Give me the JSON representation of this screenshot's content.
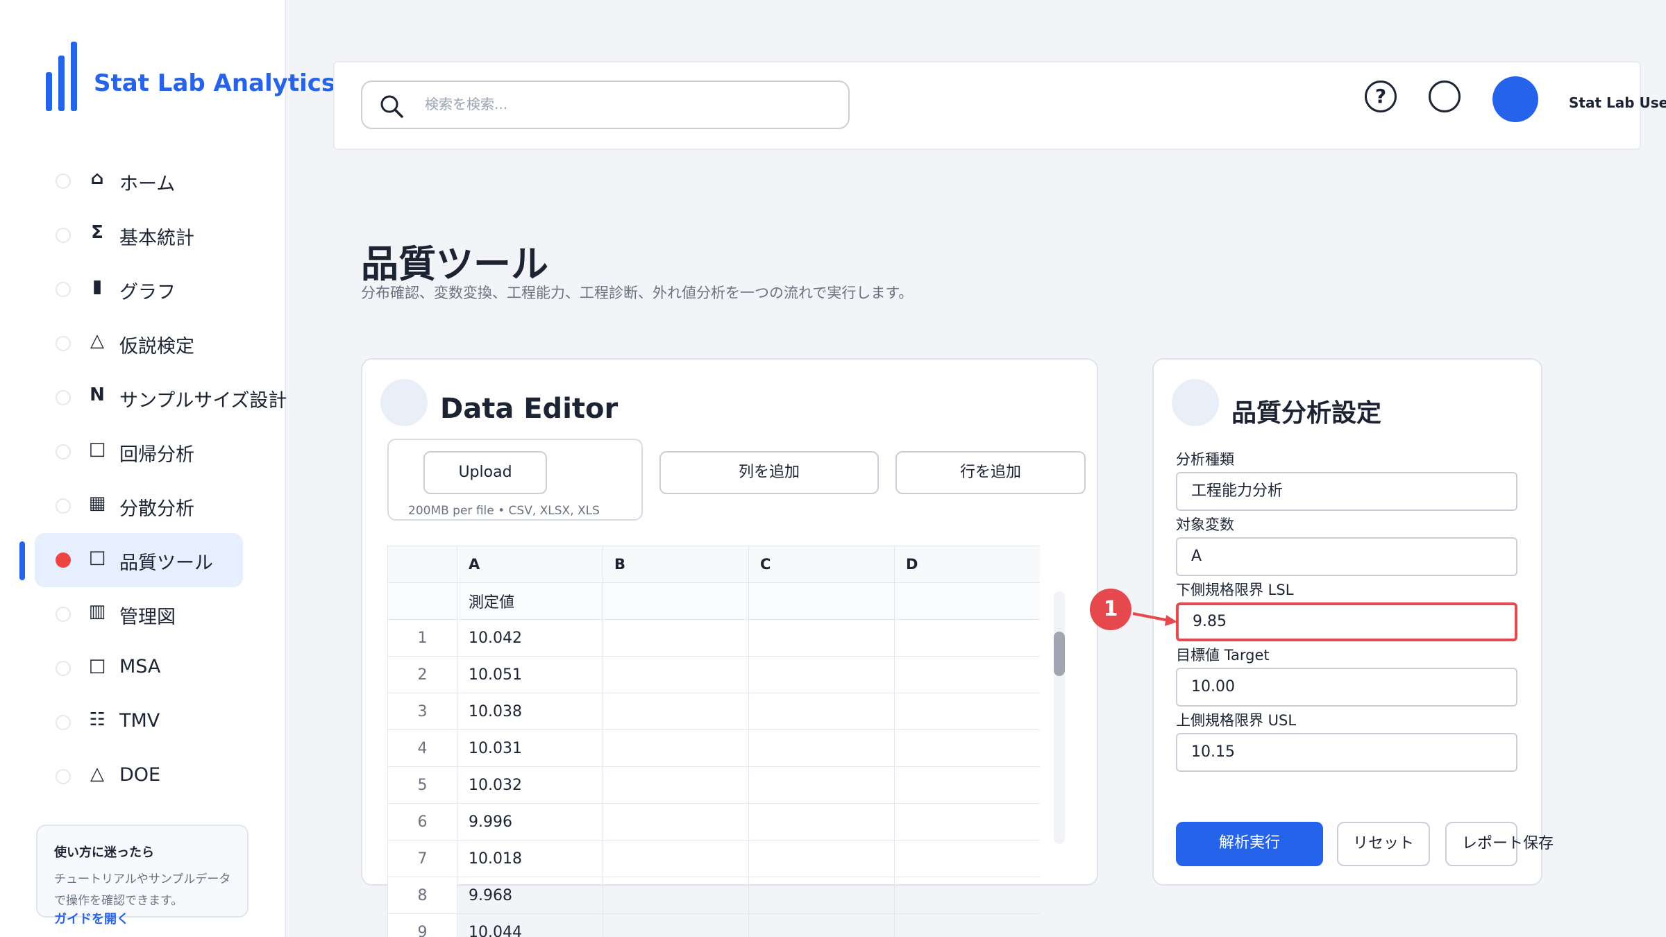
{
  "brand": {
    "name": "Stat Lab Analytics"
  },
  "sidebar": {
    "items": [
      {
        "glyph": "⌂",
        "label": "ホーム"
      },
      {
        "glyph": "Σ",
        "label": "基本統計"
      },
      {
        "glyph": "▮",
        "label": "グラフ"
      },
      {
        "glyph": "△",
        "label": "仮説検定"
      },
      {
        "glyph": "N",
        "label": "サンプルサイズ設計"
      },
      {
        "glyph": "□",
        "label": "回帰分析"
      },
      {
        "glyph": "▦",
        "label": "分散分析"
      },
      {
        "glyph": "□",
        "label": "品質ツール",
        "active": true
      },
      {
        "glyph": "▥",
        "label": "管理図"
      },
      {
        "glyph": "□",
        "label": "MSA"
      },
      {
        "glyph": "☷",
        "label": "TMV"
      },
      {
        "glyph": "△",
        "label": "DOE"
      }
    ],
    "help": {
      "title": "使い方に迷ったら",
      "body": "チュートリアルやサンプルデータで操作を確認できます。",
      "link": "ガイドを開く"
    }
  },
  "header": {
    "search_placeholder": "検索を検索...",
    "help_glyph": "?",
    "user_name": "Stat Lab User"
  },
  "page": {
    "title": "品質ツール",
    "subtitle": "分布確認、変数変換、工程能力、工程診断、外れ値分析を一つの流れで実行します。"
  },
  "editor": {
    "title": "Data Editor",
    "upload_label": "Upload",
    "upload_hint": "200MB per file • CSV, XLSX, XLS",
    "add_column_label": "列を追加",
    "add_row_label": "行を追加",
    "columns": [
      "A",
      "B",
      "C",
      "D"
    ],
    "header_row": [
      "測定値",
      "",
      "",
      ""
    ],
    "rows": [
      {
        "index": "1",
        "cells": [
          "10.042",
          "",
          "",
          ""
        ]
      },
      {
        "index": "2",
        "cells": [
          "10.051",
          "",
          "",
          ""
        ]
      },
      {
        "index": "3",
        "cells": [
          "10.038",
          "",
          "",
          ""
        ]
      },
      {
        "index": "4",
        "cells": [
          "10.031",
          "",
          "",
          ""
        ]
      },
      {
        "index": "5",
        "cells": [
          "10.032",
          "",
          "",
          ""
        ]
      },
      {
        "index": "6",
        "cells": [
          "9.996",
          "",
          "",
          ""
        ]
      },
      {
        "index": "7",
        "cells": [
          "10.018",
          "",
          "",
          ""
        ]
      },
      {
        "index": "8",
        "cells": [
          "9.968",
          "",
          "",
          ""
        ]
      },
      {
        "index": "9",
        "cells": [
          "10.044",
          "",
          "",
          ""
        ]
      }
    ]
  },
  "settings": {
    "title": "品質分析設定",
    "analysis_type_label": "分析種類",
    "analysis_type_value": "工程能力分析",
    "variable_label": "対象変数",
    "variable_value": "A",
    "lsl_label": "下側規格限界 LSL",
    "lsl_value": "9.85",
    "target_label": "目標値 Target",
    "target_value": "10.00",
    "usl_label": "上側規格限界 USL",
    "usl_value": "10.15",
    "run_label": "解析実行",
    "reset_label": "リセット",
    "report_label": "レポート保存"
  },
  "annotation": {
    "badge": "1"
  },
  "colors": {
    "accent": "#2563eb",
    "highlight": "#e5484d"
  }
}
